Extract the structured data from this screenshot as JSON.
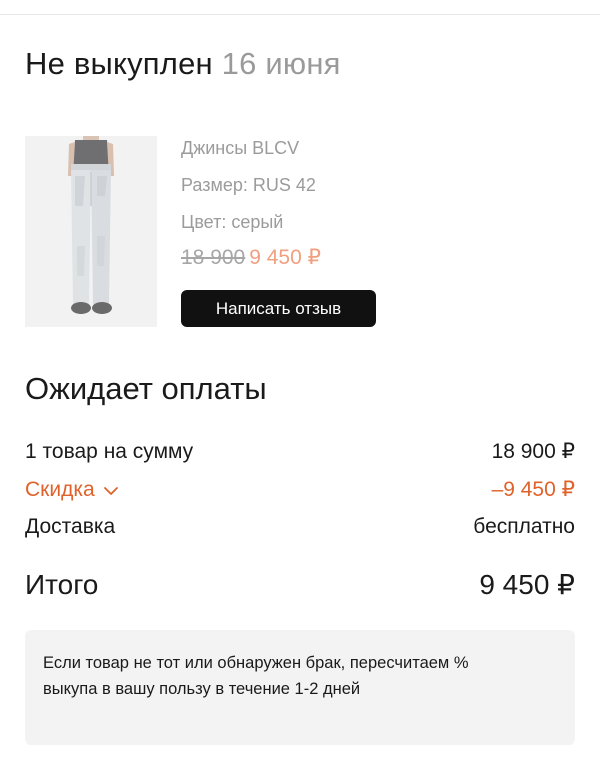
{
  "order": {
    "status": "Не выкуплен",
    "date": "16 июня"
  },
  "product": {
    "name": "Джинсы BLCV",
    "size": "Размер: RUS 42",
    "color": "Цвет: серый",
    "old_price": "18 900",
    "new_price": "9 450 ₽",
    "review_button": "Написать отзыв",
    "image_icon": "jeans-product-photo"
  },
  "payment": {
    "title": "Ожидает оплаты",
    "items_label": "1 товар на сумму",
    "items_value": "18 900 ₽",
    "discount_label": "Скидка",
    "discount_value": "–9 450 ₽",
    "delivery_label": "Доставка",
    "delivery_value": "бесплатно",
    "total_label": "Итого",
    "total_value": "9 450 ₽"
  },
  "info": {
    "text": "Если товар не тот или обнаружен брак, пересчитаем % выкупа в вашу пользу в течение 1-2 дней"
  },
  "colors": {
    "discount": "#e0622a",
    "new_price": "#f0a080",
    "button_bg": "#111111",
    "muted_text": "#9b9b9b"
  }
}
